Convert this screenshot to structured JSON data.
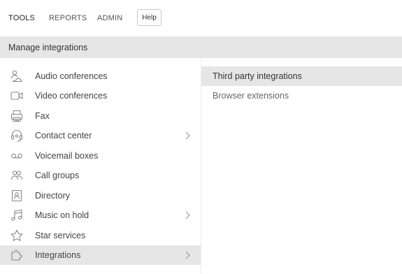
{
  "topnav": {
    "items": [
      {
        "label": "TOOLS",
        "active": true
      },
      {
        "label": "REPORTS",
        "active": false
      },
      {
        "label": "ADMIN",
        "active": false
      }
    ],
    "help_label": "Help"
  },
  "section": {
    "title": "Manage integrations"
  },
  "menu": {
    "items": [
      {
        "label": "Audio conferences",
        "icon": "audio-conference-icon",
        "has_submenu": false,
        "selected": false
      },
      {
        "label": "Video conferences",
        "icon": "video-camera-icon",
        "has_submenu": false,
        "selected": false
      },
      {
        "label": "Fax",
        "icon": "fax-icon",
        "has_submenu": false,
        "selected": false
      },
      {
        "label": "Contact center",
        "icon": "headset-icon",
        "has_submenu": true,
        "selected": false
      },
      {
        "label": "Voicemail boxes",
        "icon": "voicemail-icon",
        "has_submenu": false,
        "selected": false
      },
      {
        "label": "Call groups",
        "icon": "group-icon",
        "has_submenu": false,
        "selected": false
      },
      {
        "label": "Directory",
        "icon": "directory-icon",
        "has_submenu": false,
        "selected": false
      },
      {
        "label": "Music on hold",
        "icon": "music-note-icon",
        "has_submenu": true,
        "selected": false
      },
      {
        "label": "Star services",
        "icon": "star-icon",
        "has_submenu": false,
        "selected": false
      },
      {
        "label": "Integrations",
        "icon": "puzzle-icon",
        "has_submenu": true,
        "selected": true
      }
    ]
  },
  "submenu": {
    "items": [
      {
        "label": "Third party integrations",
        "selected": true
      },
      {
        "label": "Browser extensions",
        "selected": false
      }
    ]
  },
  "colors": {
    "selected_bg": "#e6e6e6",
    "icon_stroke": "#888888",
    "text": "#444444"
  }
}
